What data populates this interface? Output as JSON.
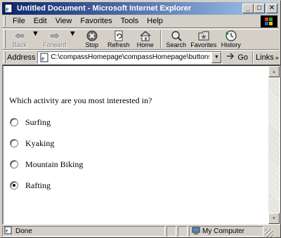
{
  "window": {
    "title": "Untitled Document - Microsoft Internet Explorer",
    "minimize": "_",
    "maximize": "□",
    "close": "✕"
  },
  "menubar": {
    "items": [
      {
        "label": "File"
      },
      {
        "label": "Edit"
      },
      {
        "label": "View"
      },
      {
        "label": "Favorites"
      },
      {
        "label": "Tools"
      },
      {
        "label": "Help"
      }
    ]
  },
  "toolbar": {
    "back": "Back",
    "forward": "Forward",
    "stop": "Stop",
    "refresh": "Refresh",
    "home": "Home",
    "search": "Search",
    "favorites": "Favorites",
    "history": "History"
  },
  "addressbar": {
    "label": "Address",
    "url": "C:\\compassHomepage\\compassHomepage\\buttons.html",
    "go": "Go",
    "links": "Links"
  },
  "page": {
    "question": "Which activity are you most interested in?",
    "options": [
      {
        "label": "Surfing",
        "checked": false
      },
      {
        "label": "Kyaking",
        "checked": false
      },
      {
        "label": "Mountain Biking",
        "checked": false
      },
      {
        "label": "Rafting",
        "checked": true
      }
    ]
  },
  "statusbar": {
    "status": "Done",
    "zone": "My Computer"
  },
  "colors": {
    "titlebar_start": "#0a246a",
    "titlebar_end": "#a6caf0",
    "chrome": "#d4d0c8"
  }
}
